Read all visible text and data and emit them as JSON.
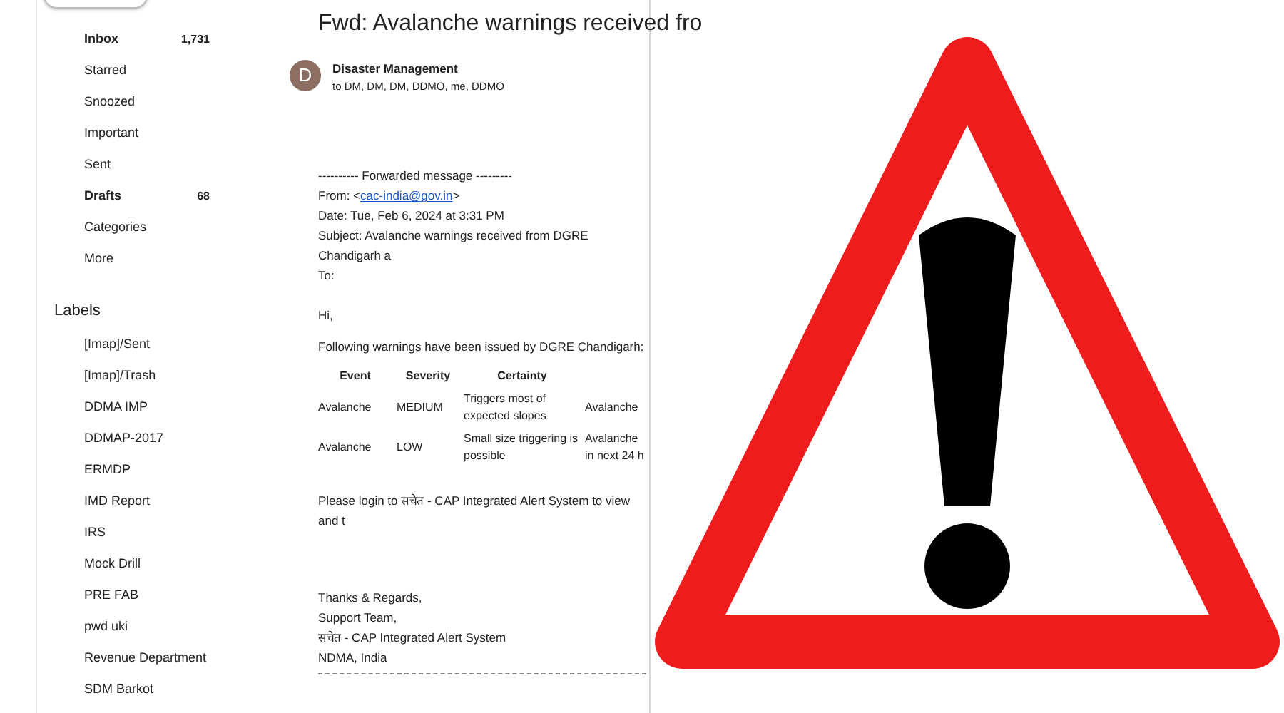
{
  "sidebar": {
    "nav_items": [
      {
        "label": "Inbox",
        "count": "1,731",
        "unread": true
      },
      {
        "label": "Starred",
        "unread": false
      },
      {
        "label": "Snoozed",
        "unread": false
      },
      {
        "label": "Important",
        "unread": false
      },
      {
        "label": "Sent",
        "unread": false
      },
      {
        "label": "Drafts",
        "count": "68",
        "unread": true
      },
      {
        "label": "Categories",
        "unread": false
      },
      {
        "label": "More",
        "unread": false
      }
    ],
    "labels_heading": "Labels",
    "labels": [
      "[Imap]/Sent",
      "[Imap]/Trash",
      "DDMA IMP",
      "DDMAP-2017",
      "ERMDP",
      "IMD Report",
      "IRS",
      "Mock Drill",
      "PRE FAB",
      "pwd uki",
      "Revenue Department",
      "SDM Barkot"
    ]
  },
  "email": {
    "subject": "Fwd: Avalanche warnings received fro",
    "sender": {
      "initial": "D",
      "name": "Disaster Management",
      "recipients": "to DM, DM, DM, DDMO, me, DDMO"
    },
    "forwarded_header": "---------- Forwarded message ---------",
    "from": {
      "before": "From: <",
      "link": "cac-india@gov.in",
      "after": ">"
    },
    "date": "Date: Tue, Feb 6, 2024 at 3:31 PM",
    "subject_line": "Subject: Avalanche warnings received from DGRE Chandigarh a",
    "to": "To:",
    "greeting": "Hi,",
    "intro": "Following warnings have been issued by DGRE Chandigarh:",
    "table": {
      "columns": [
        "Event",
        "Severity",
        "Certainty"
      ],
      "rows": [
        [
          "Avalanche",
          "MEDIUM",
          "Triggers most of expected slopes",
          "Avalanche"
        ],
        [
          "Avalanche",
          "LOW",
          "Small size triggering is possible",
          "Avalanche in next 24 h"
        ]
      ]
    },
    "login_note": "Please login to सचेत - CAP Integrated Alert System to view and t",
    "signature": [
      "Thanks & Regards,",
      "Support Team,",
      "सचेत - CAP Integrated Alert System",
      "NDMA, India"
    ]
  }
}
